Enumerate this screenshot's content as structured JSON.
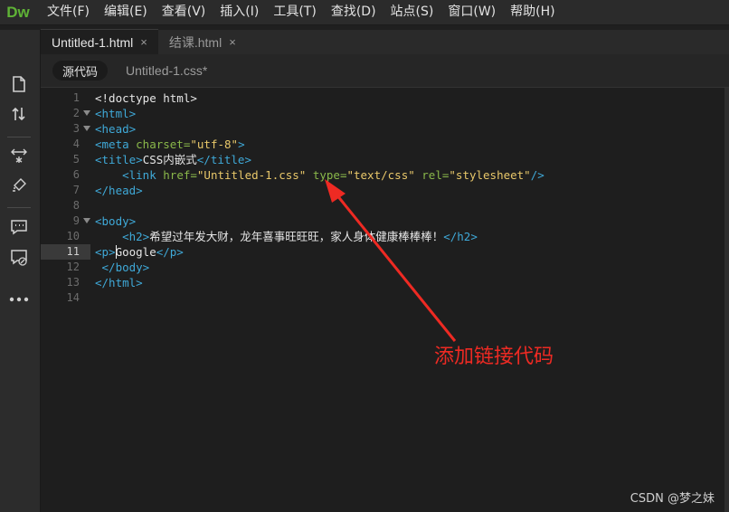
{
  "app": {
    "logo": "Dw"
  },
  "menubar": {
    "items": [
      "文件(F)",
      "编辑(E)",
      "查看(V)",
      "插入(I)",
      "工具(T)",
      "查找(D)",
      "站点(S)",
      "窗口(W)",
      "帮助(H)"
    ]
  },
  "toolbar": {
    "icons": [
      "file-icon",
      "transfer-icon",
      "expand-icon",
      "format-icon",
      "comment-icon",
      "remove-comment-icon",
      "more-icon"
    ]
  },
  "tabs": [
    {
      "label": "Untitled-1.html",
      "active": true,
      "close": "×"
    },
    {
      "label": "结课.html",
      "active": false,
      "close": "×"
    }
  ],
  "related_files": {
    "source_button": "源代码",
    "css_file": "Untitled-1.css*"
  },
  "editor": {
    "current_line": 11,
    "lines": [
      {
        "n": "1",
        "fold": false
      },
      {
        "n": "2",
        "fold": true
      },
      {
        "n": "3",
        "fold": true
      },
      {
        "n": "4",
        "fold": false
      },
      {
        "n": "5",
        "fold": false
      },
      {
        "n": "6",
        "fold": false
      },
      {
        "n": "7",
        "fold": false
      },
      {
        "n": "8",
        "fold": false
      },
      {
        "n": "9",
        "fold": true
      },
      {
        "n": "10",
        "fold": false
      },
      {
        "n": "11",
        "fold": false
      },
      {
        "n": "12",
        "fold": false
      },
      {
        "n": "13",
        "fold": false
      },
      {
        "n": "14",
        "fold": false
      }
    ],
    "code": {
      "l1": "<!doctype html>",
      "l2": "<html>",
      "l3": "<head>",
      "l4_open": "<meta ",
      "l4_attr": "charset=",
      "l4_val": "\"utf-8\"",
      "l4_close": ">",
      "l5_open": "<title>",
      "l5_text": "CSS内嵌式",
      "l5_close": "</title>",
      "l6_indent": "    ",
      "l6_open": "<link ",
      "l6_attr1": "href=",
      "l6_val1": "\"Untitled-1.css\"",
      "l6_attr2": " type=",
      "l6_val2": "\"text/css\"",
      "l6_attr3": " rel=",
      "l6_val3": "\"stylesheet\"",
      "l6_close": "/>",
      "l7": "</head>",
      "l9": "<body>",
      "l10_indent": "    ",
      "l10_open": "<h2>",
      "l10_text": "希望过年发大财，龙年喜事旺旺旺，家人身体健康棒棒棒！",
      "l10_close": "</h2>",
      "l11_open": "<p>",
      "l11_text": "Google",
      "l11_close": "</p>",
      "l12": " </body>",
      "l13": "</html>"
    }
  },
  "annotation": {
    "text": "添加链接代码",
    "color": "#ee2a23"
  },
  "watermark": "CSDN @梦之妹"
}
